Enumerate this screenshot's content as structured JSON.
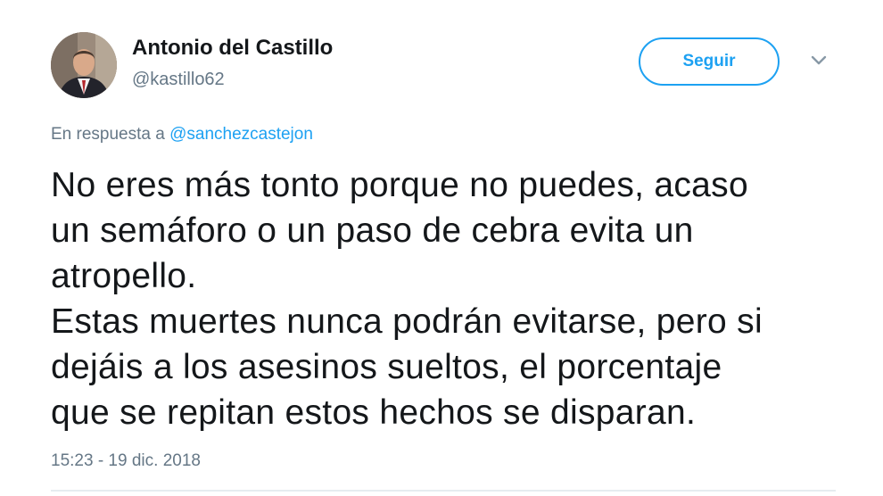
{
  "author": {
    "name": "Antonio del Castillo",
    "handle": "@kastillo62"
  },
  "follow_button": {
    "label": "Seguir"
  },
  "reply": {
    "prefix": "En respuesta a",
    "mention": "@sanchezcastejon"
  },
  "tweet": {
    "lines": [
      "No eres más tonto porque no puedes, acaso",
      "un semáforo o un paso de cebra evita un",
      "atropello.",
      "Estas muertes nunca podrán evitarse, pero si",
      "dejáis a los asesinos sueltos, el porcentaje",
      "que se repitan estos hechos se disparan."
    ]
  },
  "timestamp": "15:23 - 19 dic. 2018",
  "colors": {
    "accent": "#1da1f2",
    "text": "#14171a",
    "muted": "#657786"
  },
  "icons": {
    "more": "chevron-down-icon",
    "avatar": "profile-photo"
  }
}
